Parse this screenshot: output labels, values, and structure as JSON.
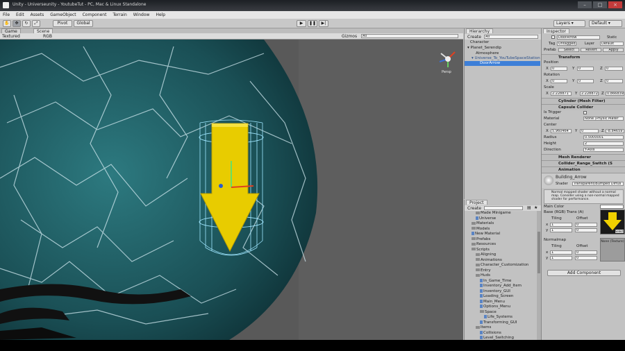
{
  "window": {
    "title": "Unity - Universeunity - YoutubeTut - PC, Mac & Linux Standalone"
  },
  "menu": [
    "File",
    "Edit",
    "Assets",
    "GameObject",
    "Component",
    "Terrain",
    "Window",
    "Help"
  ],
  "toolbar": {
    "pivot": "Pivot",
    "global": "Global",
    "layers": "Layers",
    "layout": "Default"
  },
  "scene": {
    "tabs": [
      "Game",
      "Scene"
    ],
    "shading": "Textured",
    "render": "RGB",
    "gizmos": "Gizmos",
    "search_placeholder": "All",
    "persp": "Persp"
  },
  "hierarchy": {
    "tab": "Hierarchy",
    "create": "Create",
    "search_placeholder": "All",
    "items": [
      "Character",
      "Planet_Serendip",
      "Atmosphere",
      "Universe_To_YouTubeSpaceStation",
      "DoorArrow"
    ],
    "selected": "DoorArrow"
  },
  "inspector": {
    "tab": "Inspector",
    "name": "DoorArrow",
    "static": "Static",
    "tag_label": "Tag",
    "tag": "Untagged",
    "layer_label": "Layer",
    "layer": "Default",
    "prefab_label": "Prefab",
    "prefab_buttons": [
      "Select",
      "Revert",
      "Apply"
    ],
    "transform": {
      "title": "Transform",
      "position_label": "Position",
      "position": [
        "0",
        "0",
        "0"
      ],
      "rotation_label": "Rotation",
      "rotation": [
        "0",
        "0",
        "0"
      ],
      "scale_label": "Scale",
      "scale": [
        "2.228871",
        "2.228872",
        "0.866839"
      ]
    },
    "mesh_filter": "Cylinder (Mesh Filter)",
    "capsule": {
      "title": "Capsule Collider",
      "is_trigger_label": "Is Trigger",
      "material_label": "Material",
      "material": "None (Physic Mater",
      "center_label": "Center",
      "center": [
        "5.960464",
        "0",
        "-8.84659"
      ],
      "radius_label": "Radius",
      "radius": "0.5000001",
      "height_label": "Height",
      "height": "2",
      "direction_label": "Direction",
      "direction": "Y-Axis"
    },
    "components": [
      "Mesh Renderer",
      "Collider_Range_Switch (S",
      "Animation"
    ],
    "material": {
      "name": "Building_Arrow",
      "shader_label": "Shader",
      "shader": "Transparent/Bumped Diffus",
      "note": "Normal mapped shader without a normal map. Consider using a non-normal mapped shader for performance.",
      "main_color_label": "Main Color",
      "base_label": "Base (RGB) Trans (A)",
      "tiling_label": "Tiling",
      "offset_label": "Offset",
      "tiling": [
        "1",
        "1"
      ],
      "offset": [
        "0",
        "0"
      ],
      "normalmap_label": "Normalmap",
      "normal_tiling": [
        "1",
        "1"
      ],
      "normal_offset": [
        "0",
        "0"
      ],
      "none_texture": "None (Texture)",
      "select": "Select"
    },
    "add_component": "Add Component"
  },
  "project": {
    "tab": "Project",
    "create": "Create",
    "items": [
      {
        "t": "Made Minigame",
        "d": 2,
        "k": "folder"
      },
      {
        "t": "Universe",
        "d": 2,
        "k": "scene"
      },
      {
        "t": "Materials",
        "d": 1,
        "k": "folder"
      },
      {
        "t": "Models",
        "d": 1,
        "k": "folder"
      },
      {
        "t": "New Material",
        "d": 1,
        "k": "mat"
      },
      {
        "t": "Prefabs",
        "d": 1,
        "k": "folder"
      },
      {
        "t": "Resources",
        "d": 1,
        "k": "folder"
      },
      {
        "t": "Scripts",
        "d": 1,
        "k": "folder"
      },
      {
        "t": "Aligning",
        "d": 2,
        "k": "folder"
      },
      {
        "t": "Animations",
        "d": 2,
        "k": "folder"
      },
      {
        "t": "Character_Customization",
        "d": 2,
        "k": "folder"
      },
      {
        "t": "Entry",
        "d": 2,
        "k": "folder"
      },
      {
        "t": "Huds",
        "d": 2,
        "k": "folder"
      },
      {
        "t": "In_Game_Time",
        "d": 3,
        "k": "script"
      },
      {
        "t": "Inventory_Add_Item",
        "d": 3,
        "k": "script"
      },
      {
        "t": "Inventory_GUI",
        "d": 3,
        "k": "script"
      },
      {
        "t": "Loading_Screen",
        "d": 3,
        "k": "script"
      },
      {
        "t": "Main_Menu",
        "d": 3,
        "k": "script"
      },
      {
        "t": "Options_Menu",
        "d": 3,
        "k": "script"
      },
      {
        "t": "Space",
        "d": 3,
        "k": "folder"
      },
      {
        "t": "Life_Systems",
        "d": 4,
        "k": "script"
      },
      {
        "t": "Transforming_GUI",
        "d": 3,
        "k": "script"
      },
      {
        "t": "Items",
        "d": 2,
        "k": "folder"
      },
      {
        "t": "Collisions",
        "d": 3,
        "k": "script"
      },
      {
        "t": "Level_Switching",
        "d": 3,
        "k": "script"
      }
    ]
  },
  "colors": {
    "accent": "#3d7fd8",
    "arrow": "#f0d000",
    "planet": "#1f5a60",
    "panel": "#c2c2c2"
  }
}
